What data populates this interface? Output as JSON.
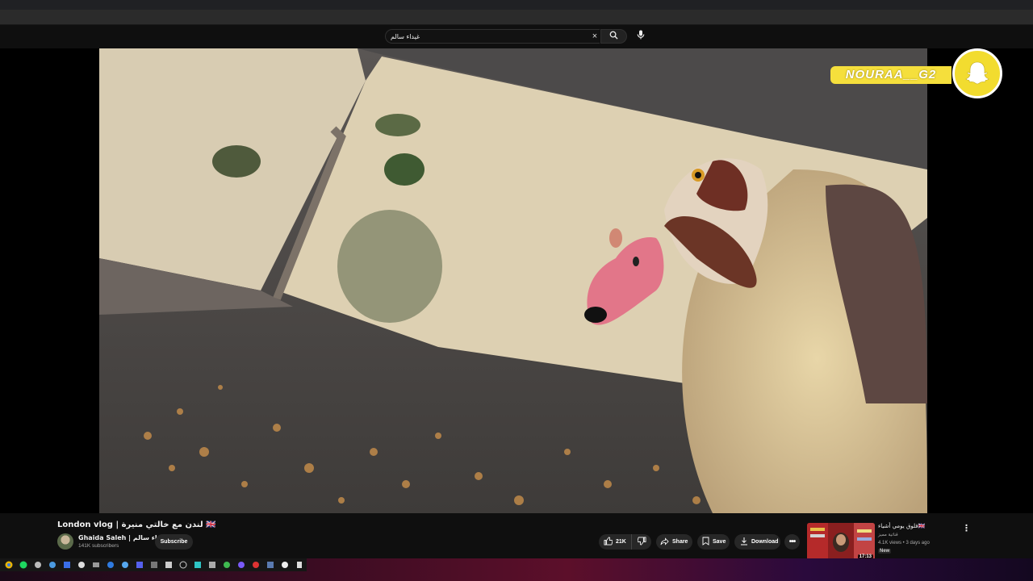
{
  "search": {
    "value": "غيداء سالم",
    "clear_icon": "×",
    "search_icon": "search-icon",
    "mic_icon": "mic-icon"
  },
  "watermark": {
    "text": "NOURAA__G2",
    "icon": "snapchat-ghost-icon",
    "color": "#f5df3c"
  },
  "video": {
    "title": "London vlog | لندن مع خالتي منيرة 🇬🇧",
    "channel_name": "Ghaida Saleh | غيداء سالم",
    "subscribers": "141K subscribers",
    "subscribe_label": "Subscribe",
    "like_count": "21K",
    "share_label": "Share",
    "save_label": "Save",
    "download_label": "Download",
    "more_label": "•••"
  },
  "recommended": {
    "title": "فلوق يومي أشياء🇬🇧",
    "channel": "قناتية مميز",
    "meta": "4.1K views • 3 days ago",
    "badge": "New",
    "duration": "17:13",
    "menu": "⋮"
  },
  "colors": {
    "header_bg": "#0f0f0f",
    "pill_bg": "#272727",
    "accent_yellow": "#f5df3c"
  }
}
